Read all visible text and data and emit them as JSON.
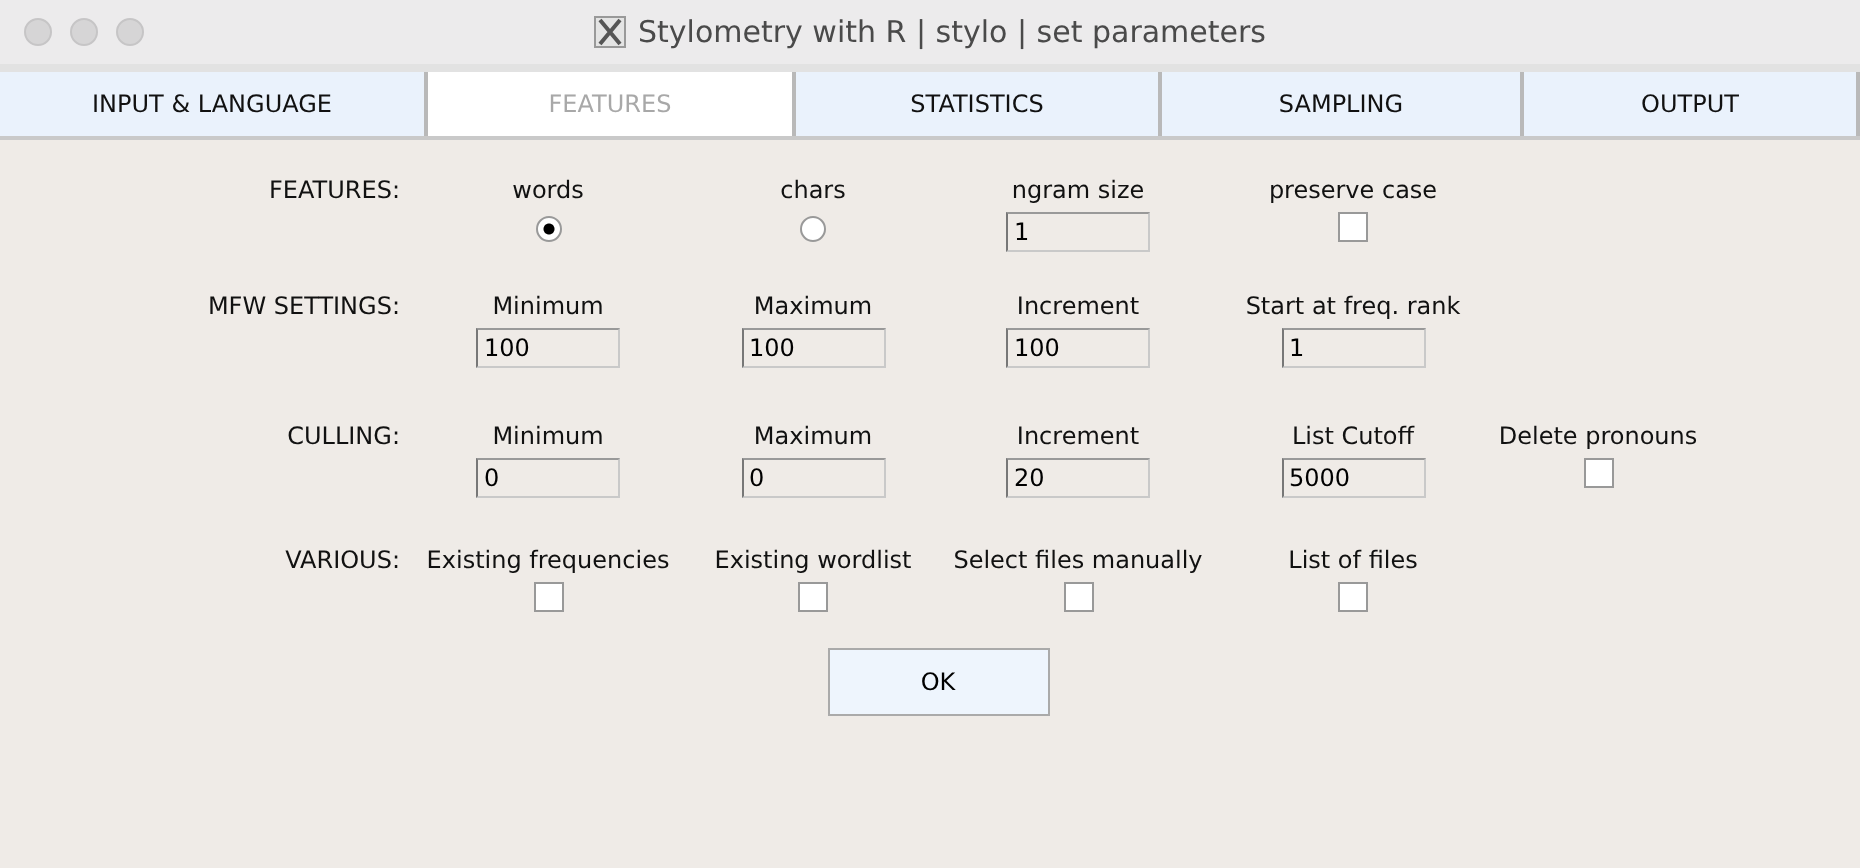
{
  "window": {
    "title": "Stylometry with R | stylo | set parameters"
  },
  "tabs": [
    {
      "label": "INPUT & LANGUAGE",
      "selected": false
    },
    {
      "label": "FEATURES",
      "selected": true
    },
    {
      "label": "STATISTICS",
      "selected": false
    },
    {
      "label": "SAMPLING",
      "selected": false
    },
    {
      "label": "OUTPUT",
      "selected": false
    }
  ],
  "rows": [
    {
      "label": "FEATURES:",
      "items": [
        {
          "kind": "radio",
          "label": "words",
          "selected": true
        },
        {
          "kind": "radio",
          "label": "chars",
          "selected": false
        },
        {
          "kind": "input",
          "label": "ngram size",
          "value": "1"
        },
        {
          "kind": "checkbox",
          "label": "preserve case",
          "checked": false
        }
      ]
    },
    {
      "label": "MFW SETTINGS:",
      "items": [
        {
          "kind": "input",
          "label": "Minimum",
          "value": "100"
        },
        {
          "kind": "input",
          "label": "Maximum",
          "value": "100"
        },
        {
          "kind": "input",
          "label": "Increment",
          "value": "100"
        },
        {
          "kind": "input",
          "label": "Start at freq. rank",
          "value": "1"
        }
      ]
    },
    {
      "label": "CULLING:",
      "items": [
        {
          "kind": "input",
          "label": "Minimum",
          "value": "0"
        },
        {
          "kind": "input",
          "label": "Maximum",
          "value": "0"
        },
        {
          "kind": "input",
          "label": "Increment",
          "value": "20"
        },
        {
          "kind": "input",
          "label": "List Cutoff",
          "value": "5000"
        },
        {
          "kind": "checkbox",
          "label": "Delete pronouns",
          "checked": false
        }
      ]
    },
    {
      "label": "VARIOUS:",
      "items": [
        {
          "kind": "checkbox",
          "label": "Existing frequencies",
          "checked": false
        },
        {
          "kind": "checkbox",
          "label": "Existing wordlist",
          "checked": false
        },
        {
          "kind": "checkbox",
          "label": "Select files manually",
          "checked": false
        },
        {
          "kind": "checkbox",
          "label": "List of files",
          "checked": false
        }
      ]
    }
  ],
  "buttons": [
    "OK"
  ]
}
